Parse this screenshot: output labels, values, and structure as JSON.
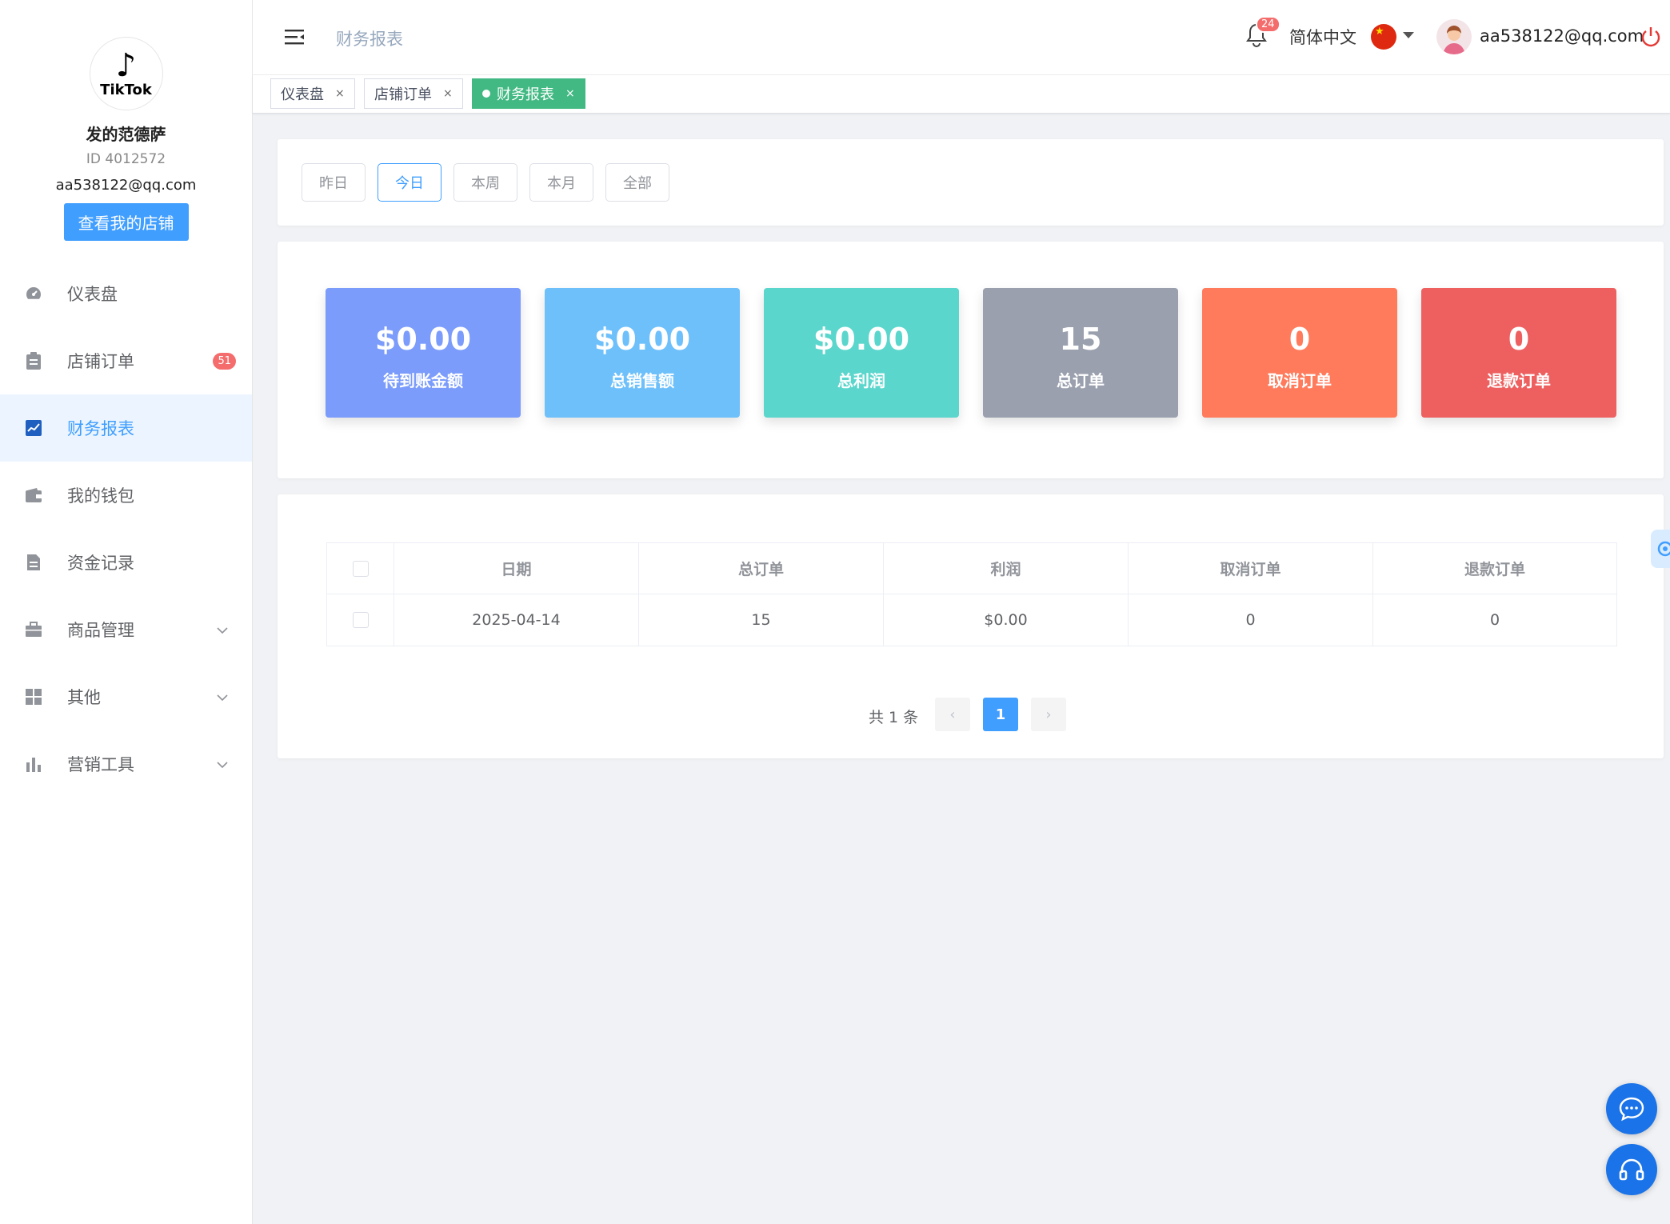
{
  "sidebar": {
    "logo_word": "TikTok",
    "shop_name": "发的范德萨",
    "shop_id": "ID 4012572",
    "email": "aa538122@qq.com",
    "view_shop_button": "查看我的店铺",
    "items": [
      {
        "label": "仪表盘",
        "icon": "dashboard-icon"
      },
      {
        "label": "店铺订单",
        "icon": "clipboard-icon",
        "badge": "51"
      },
      {
        "label": "财务报表",
        "icon": "chart-icon",
        "active": true
      },
      {
        "label": "我的钱包",
        "icon": "wallet-icon"
      },
      {
        "label": "资金记录",
        "icon": "document-icon"
      },
      {
        "label": "商品管理",
        "icon": "briefcase-icon",
        "expandable": true
      },
      {
        "label": "其他",
        "icon": "grid-icon",
        "expandable": true
      },
      {
        "label": "营销工具",
        "icon": "bar-chart-icon",
        "expandable": true
      }
    ]
  },
  "header": {
    "breadcrumb": "财务报表",
    "notification_count": "24",
    "language": "简体中文",
    "user_email": "aa538122@qq.com"
  },
  "tags": [
    {
      "label": "仪表盘"
    },
    {
      "label": "店铺订单"
    },
    {
      "label": "财务报表",
      "active": true
    }
  ],
  "filters": [
    {
      "label": "昨日"
    },
    {
      "label": "今日",
      "active": true
    },
    {
      "label": "本周"
    },
    {
      "label": "本月"
    },
    {
      "label": "全部"
    }
  ],
  "stats": [
    {
      "value": "$0.00",
      "label": "待到账金额",
      "color": "#7b9cfb"
    },
    {
      "value": "$0.00",
      "label": "总销售额",
      "color": "#6ec0fb"
    },
    {
      "value": "$0.00",
      "label": "总利润",
      "color": "#5ad6cc"
    },
    {
      "value": "15",
      "label": "总订单",
      "color": "#9aa0ae"
    },
    {
      "value": "0",
      "label": "取消订单",
      "color": "#ff7b5c"
    },
    {
      "value": "0",
      "label": "退款订单",
      "color": "#ee6060"
    }
  ],
  "table": {
    "columns": [
      "日期",
      "总订单",
      "利润",
      "取消订单",
      "退款订单"
    ],
    "rows": [
      [
        "2025-04-14",
        "15",
        "$0.00",
        "0",
        "0"
      ]
    ]
  },
  "pagination": {
    "total_text": "共 1 条",
    "current_page": "1",
    "prev": "‹",
    "next": "›"
  },
  "colors": {
    "primary": "#409eff",
    "tag_active": "#42b983",
    "badge": "#f56c6c",
    "fab": "#1a73e8"
  }
}
